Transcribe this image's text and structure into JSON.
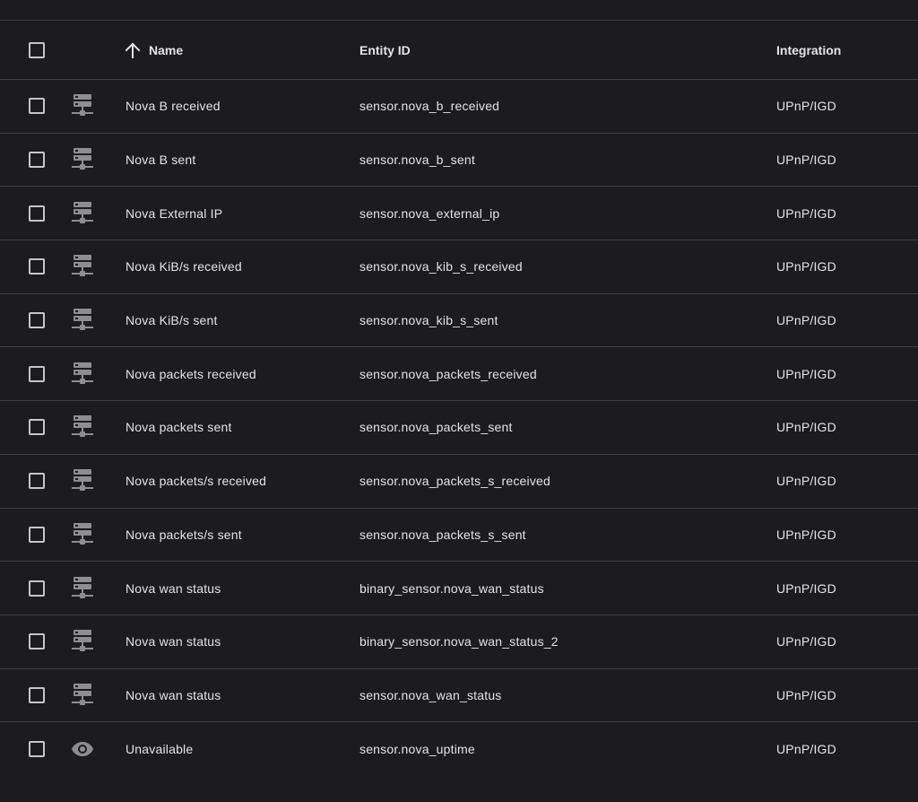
{
  "table": {
    "headers": {
      "name": "Name",
      "entity_id": "Entity ID",
      "integration": "Integration"
    },
    "sort": {
      "column": "name",
      "direction": "ascending",
      "icon": "arrow-up-icon"
    },
    "rows": [
      {
        "icon": "server-network-icon",
        "name": "Nova B received",
        "entity_id": "sensor.nova_b_received",
        "integration": "UPnP/IGD"
      },
      {
        "icon": "server-network-icon",
        "name": "Nova B sent",
        "entity_id": "sensor.nova_b_sent",
        "integration": "UPnP/IGD"
      },
      {
        "icon": "server-network-icon",
        "name": "Nova External IP",
        "entity_id": "sensor.nova_external_ip",
        "integration": "UPnP/IGD"
      },
      {
        "icon": "server-network-icon",
        "name": "Nova KiB/s received",
        "entity_id": "sensor.nova_kib_s_received",
        "integration": "UPnP/IGD"
      },
      {
        "icon": "server-network-icon",
        "name": "Nova KiB/s sent",
        "entity_id": "sensor.nova_kib_s_sent",
        "integration": "UPnP/IGD"
      },
      {
        "icon": "server-network-icon",
        "name": "Nova packets received",
        "entity_id": "sensor.nova_packets_received",
        "integration": "UPnP/IGD"
      },
      {
        "icon": "server-network-icon",
        "name": "Nova packets sent",
        "entity_id": "sensor.nova_packets_sent",
        "integration": "UPnP/IGD"
      },
      {
        "icon": "server-network-icon",
        "name": "Nova packets/s received",
        "entity_id": "sensor.nova_packets_s_received",
        "integration": "UPnP/IGD"
      },
      {
        "icon": "server-network-icon",
        "name": "Nova packets/s sent",
        "entity_id": "sensor.nova_packets_s_sent",
        "integration": "UPnP/IGD"
      },
      {
        "icon": "server-network-icon",
        "name": "Nova wan status",
        "entity_id": "binary_sensor.nova_wan_status",
        "integration": "UPnP/IGD"
      },
      {
        "icon": "server-network-icon",
        "name": "Nova wan status",
        "entity_id": "binary_sensor.nova_wan_status_2",
        "integration": "UPnP/IGD"
      },
      {
        "icon": "server-network-icon",
        "name": "Nova wan status",
        "entity_id": "sensor.nova_wan_status",
        "integration": "UPnP/IGD"
      },
      {
        "icon": "eye-icon",
        "name": "Unavailable",
        "entity_id": "sensor.nova_uptime",
        "integration": "UPnP/IGD"
      }
    ]
  },
  "colors": {
    "background": "#1c1b1f",
    "text": "#e6e3e8",
    "divider": "#3f3e42",
    "icon": "#8e8d92"
  }
}
